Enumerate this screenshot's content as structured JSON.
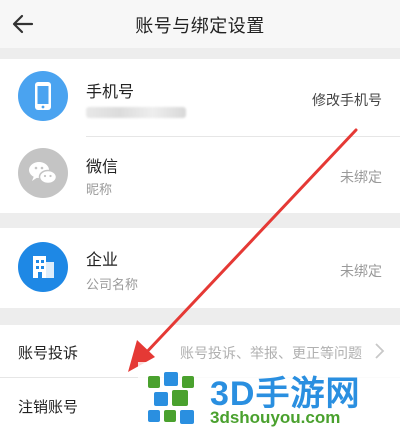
{
  "header": {
    "title": "账号与绑定设置"
  },
  "accounts": {
    "phone": {
      "title": "手机号",
      "action": "修改手机号"
    },
    "wechat": {
      "title": "微信",
      "subtitle": "昵称",
      "status": "未绑定"
    },
    "enterprise": {
      "title": "企业",
      "subtitle": "公司名称",
      "status": "未绑定"
    }
  },
  "menu": {
    "complaint": {
      "label": "账号投诉",
      "hint": "账号投诉、举报、更正等问题"
    },
    "cancel": {
      "label": "注销账号"
    }
  },
  "watermark": {
    "name": "3D手游网",
    "url": "3dshouyou.com"
  },
  "colors": {
    "phone_icon": "#4aa3f0",
    "wechat_icon": "#c4c4c4",
    "enterprise_icon": "#1e88e5",
    "annotation_arrow": "#e53935",
    "background": "#ededed"
  }
}
